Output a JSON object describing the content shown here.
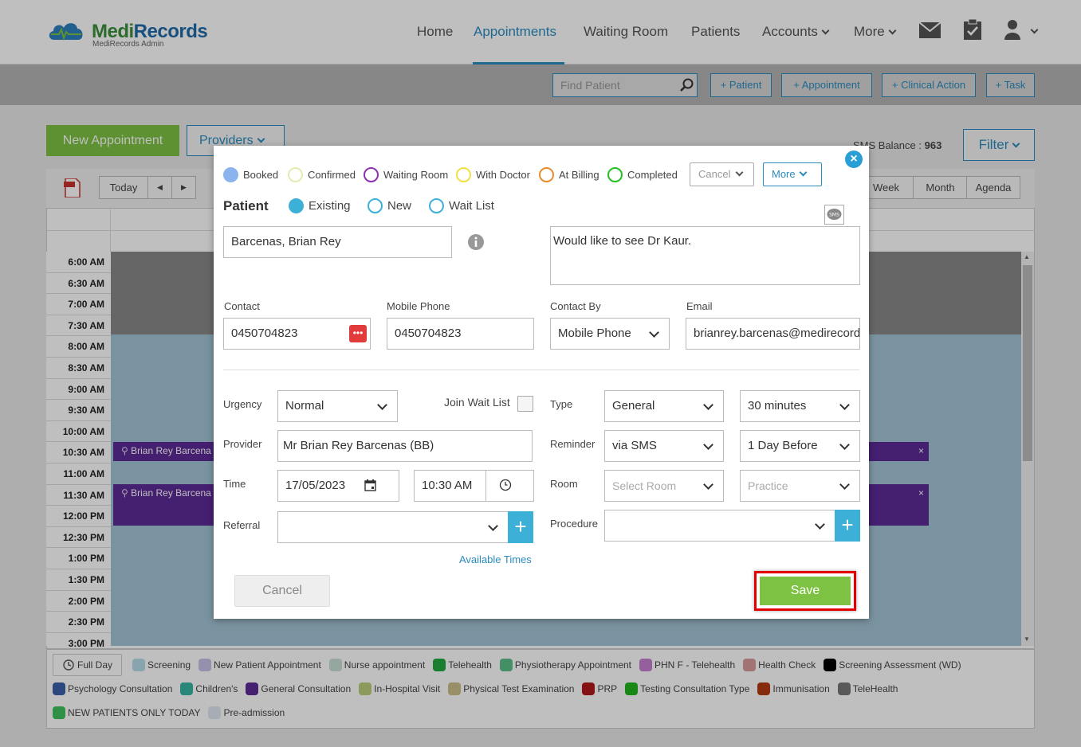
{
  "app": {
    "brand_medi": "Medi",
    "brand_records": "Records",
    "subtitle": "MediRecords Admin"
  },
  "nav": {
    "home": "Home",
    "appointments": "Appointments",
    "waiting_room": "Waiting Room",
    "patients": "Patients",
    "accounts": "Accounts",
    "more": "More"
  },
  "actionbar": {
    "find_placeholder": "Find Patient",
    "add_patient": "+ Patient",
    "add_appointment": "+ Appointment",
    "add_clinical_action": "+ Clinical Action",
    "add_task": "+ Task"
  },
  "page": {
    "new_appointment": "New Appointment",
    "providers": "Providers",
    "sms_balance_label": "SMS Balance : ",
    "sms_balance_value": "963",
    "filter": "Filter"
  },
  "calendar_toolbar": {
    "today": "Today",
    "prev": "◀",
    "next": "▶",
    "week": "Week",
    "month": "Month",
    "agenda": "Agenda"
  },
  "time_slots": [
    "6:00 AM",
    "6:30 AM",
    "7:00 AM",
    "7:30 AM",
    "8:00 AM",
    "8:30 AM",
    "9:00 AM",
    "9:30 AM",
    "10:00 AM",
    "10:30 AM",
    "11:00 AM",
    "11:30 AM",
    "12:00 PM",
    "12:30 PM",
    "1:00 PM",
    "1:30 PM",
    "2:00 PM",
    "2:30 PM",
    "3:00 PM"
  ],
  "appointments": [
    {
      "label": "Brian Rey Barcena"
    },
    {
      "label": "Brian Rey Barcena"
    }
  ],
  "legend": {
    "full_day": "Full Day",
    "items": [
      {
        "label": "Screening",
        "color": "#b7dbe8"
      },
      {
        "label": "New Patient Appointment",
        "color": "#c7c0e6"
      },
      {
        "label": "Nurse appointment",
        "color": "#c9dfd6"
      },
      {
        "label": "Telehealth",
        "color": "#1faa3c"
      },
      {
        "label": "Physiotherapy Appointment",
        "color": "#5cbf8a"
      },
      {
        "label": "PHN F - Telehealth",
        "color": "#c77ed1"
      },
      {
        "label": "Health Check",
        "color": "#d99a9a"
      },
      {
        "label": "Screening Assessment (WD)",
        "color": "#000000"
      },
      {
        "label": "Psychology Consultation",
        "color": "#3a5fa8"
      },
      {
        "label": "Children's",
        "color": "#36b5a0"
      },
      {
        "label": "General Consultation",
        "color": "#5c2a96"
      },
      {
        "label": "In-Hospital Visit",
        "color": "#b9cf7a"
      },
      {
        "label": "Physical Test Examination",
        "color": "#cbbf8a"
      },
      {
        "label": "PRP",
        "color": "#b01818"
      },
      {
        "label": "Testing Consultation Type",
        "color": "#22b51e"
      },
      {
        "label": "Immunisation",
        "color": "#b53a12"
      },
      {
        "label": "TeleHealth",
        "color": "#777777"
      },
      {
        "label": "NEW PATIENTS ONLY TODAY",
        "color": "#3ec25e"
      },
      {
        "label": "Pre-admission",
        "color": "#dfe7f2"
      }
    ]
  },
  "modal": {
    "statuses": [
      {
        "label": "Booked",
        "color": "#8bb4ee",
        "filled": true
      },
      {
        "label": "Confirmed",
        "color": "#e3ecb0",
        "filled": false
      },
      {
        "label": "Waiting Room",
        "color": "#8e2fb2",
        "filled": false
      },
      {
        "label": "With Doctor",
        "color": "#f0e044",
        "filled": false
      },
      {
        "label": "At Billing",
        "color": "#e98a2b",
        "filled": false
      },
      {
        "label": "Completed",
        "color": "#22c21e",
        "filled": false
      }
    ],
    "cancel_select": "Cancel",
    "more_select": "More",
    "patient_heading": "Patient",
    "patient_types": {
      "existing": "Existing",
      "new": "New",
      "wait_list": "Wait List"
    },
    "patient_name": "Barcenas, Brian Rey",
    "notes": "Would like to see Dr Kaur.",
    "contact_label": "Contact",
    "contact_value": "0450704823",
    "mobile_label": "Mobile Phone",
    "mobile_value": "0450704823",
    "contact_by_label": "Contact By",
    "contact_by_value": "Mobile Phone",
    "email_label": "Email",
    "email_value": "brianrey.barcenas@medirecords.com",
    "urgency_label": "Urgency",
    "urgency_value": "Normal",
    "join_wait_list_label": "Join Wait List",
    "type_label": "Type",
    "type_value": "General",
    "duration_value": "30 minutes",
    "provider_label": "Provider",
    "provider_value": "Mr Brian Rey Barcenas (BB)",
    "reminder_label": "Reminder",
    "reminder_value": "via SMS",
    "reminder_when_value": "1 Day Before",
    "time_label": "Time",
    "date_value": "17/05/2023",
    "time_value": "10:30 AM",
    "room_label": "Room",
    "room_placeholder": "Select Room",
    "practice_placeholder": "Practice",
    "referral_label": "Referral",
    "procedure_label": "Procedure",
    "available_times": "Available Times",
    "cancel_button": "Cancel",
    "save_button": "Save"
  }
}
